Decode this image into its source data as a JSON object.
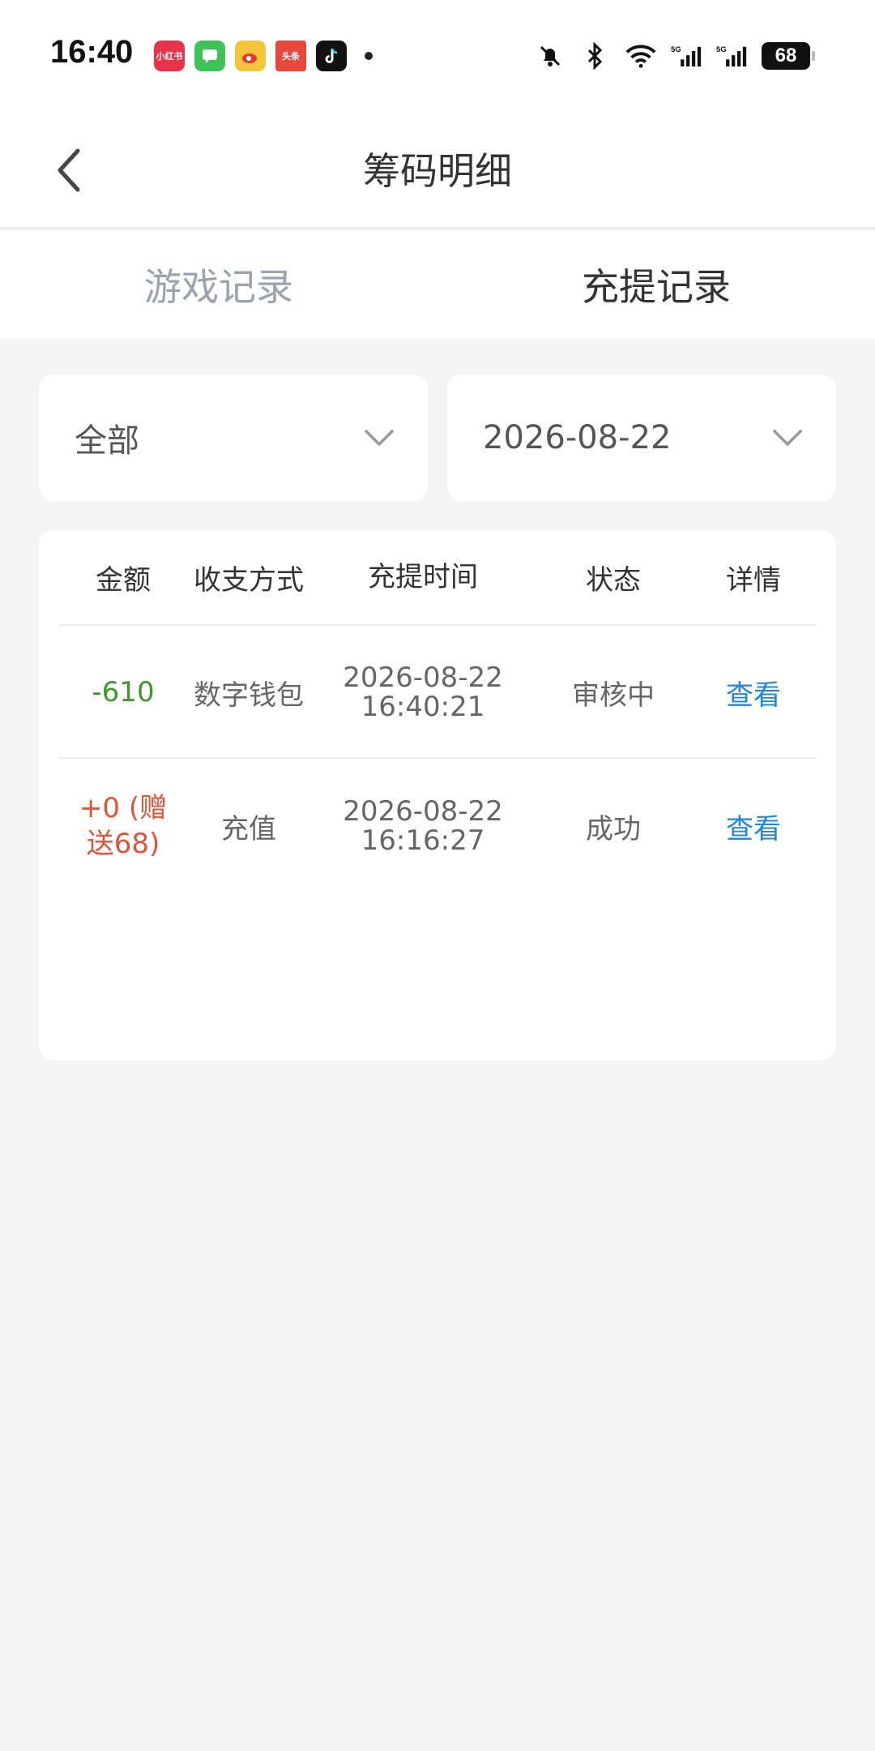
{
  "status_bar": {
    "time": "16:40",
    "battery": "68",
    "app_icons": [
      {
        "name": "xiaohongshu-icon",
        "label": "小红书",
        "color": "#e8334a"
      },
      {
        "name": "messages-icon",
        "label": "",
        "color": "#3fc356"
      },
      {
        "name": "weibo-icon",
        "label": "",
        "color": "#f4c43b"
      },
      {
        "name": "toutiao-icon",
        "label": "头条",
        "color": "#e8473c"
      },
      {
        "name": "tiktok-icon",
        "label": "",
        "color": "#111111"
      }
    ]
  },
  "header": {
    "title": "筹码明细"
  },
  "tabs": [
    {
      "label": "游戏记录",
      "active": false
    },
    {
      "label": "充提记录",
      "active": true
    }
  ],
  "filters": {
    "type": "全部",
    "date": "2026-08-22"
  },
  "table": {
    "headers": [
      "金额",
      "收支方式",
      "充提时间",
      "状态",
      "详情"
    ],
    "rows": [
      {
        "amount": "-610",
        "method": "数字钱包",
        "date": "2026-08-22",
        "time": "16:40:21",
        "status": "审核中",
        "detail": "查看"
      },
      {
        "amount_line1": "+0 (赠",
        "amount_line2": "送68)",
        "method": "充值",
        "date": "2026-08-22",
        "time": "16:16:27",
        "status": "成功",
        "detail": "查看"
      }
    ]
  },
  "colors": {
    "negative": "#3a9a2a",
    "positive": "#e0543a",
    "link": "#1f86d8",
    "inactive_tab": "#9aa3af"
  }
}
